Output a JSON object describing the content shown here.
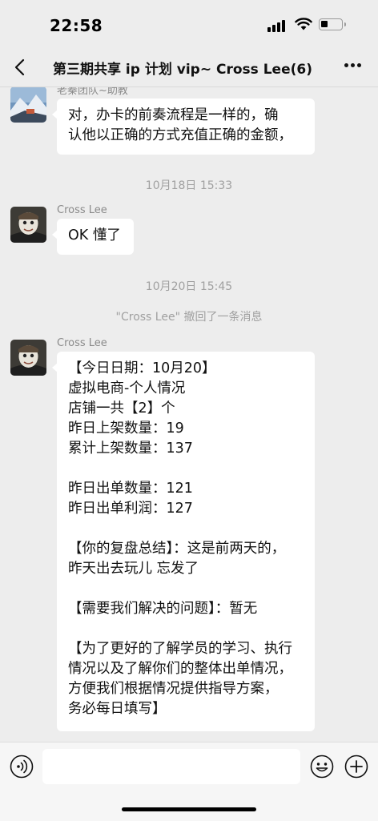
{
  "status_bar": {
    "time": "22:58"
  },
  "header": {
    "title": "第三期共享 ip 计划 vip~ Cross Lee(6)"
  },
  "messages": [
    {
      "sender": "老秦团队~助教",
      "text": "对，办卡的前奏流程是一样的，确\n认他以正确的方式充值正确的金额，"
    },
    {
      "sender": "Cross Lee",
      "text": "OK 懂了"
    },
    {
      "sender": "Cross Lee",
      "text": "【今日日期：10月20】\n虚拟电商-个人情况\n店铺一共【2】个\n昨日上架数量：19\n累计上架数量：137\n\n昨日出单数量：121\n昨日出单利润：127\n\n【你的复盘总结】：这是前两天的，\n昨天出去玩儿 忘发了\n\n【需要我们解决的问题】：暂无\n\n【为了更好的了解学员的学习、执行\n情况以及了解你们的整体出单情况，\n方便我们根据情况提供指导方案，\n务必每日填写】"
    }
  ],
  "timestamps": [
    "10月18日 15:33",
    "10月20日 15:45"
  ],
  "system_notice": "\"Cross Lee\" 撤回了一条消息",
  "input_bar": {
    "value": ""
  },
  "icons": [
    "back-arrow-icon",
    "more-icon",
    "voice-icon",
    "emoji-icon",
    "plus-icon"
  ]
}
